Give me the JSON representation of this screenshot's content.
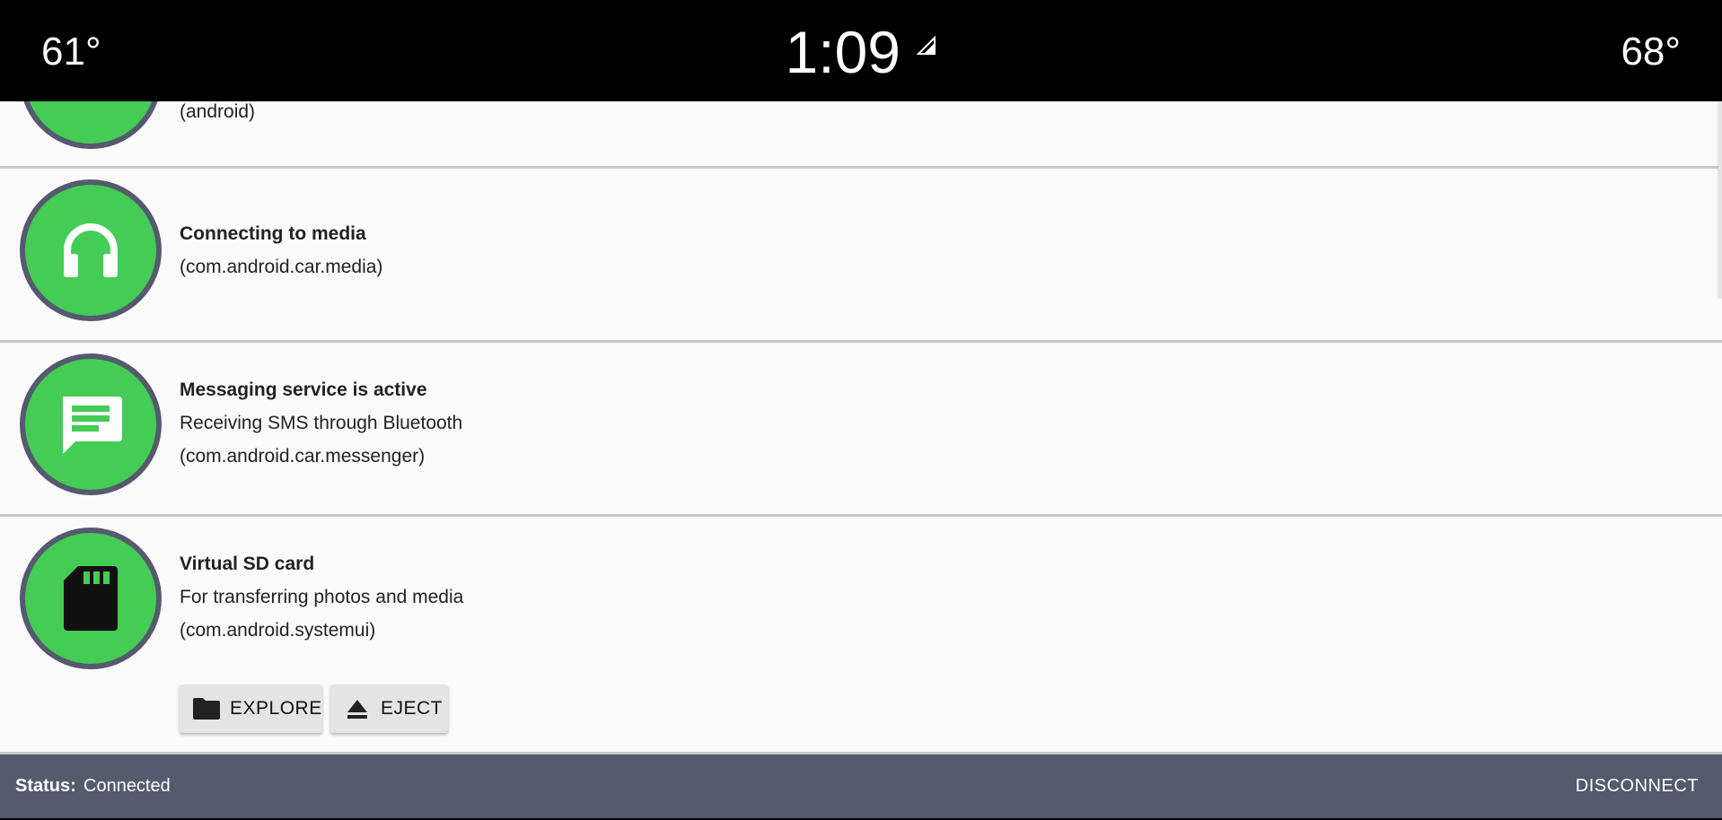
{
  "status_bar": {
    "temp_left": "61°",
    "clock": "1:09",
    "temp_right": "68°"
  },
  "notifications": [
    {
      "icon": "android-icon",
      "title": "",
      "lines": [
        "(android)"
      ]
    },
    {
      "icon": "headphones-icon",
      "title": "Connecting to media",
      "lines": [
        "(com.android.car.media)"
      ]
    },
    {
      "icon": "message-icon",
      "title": "Messaging service is active",
      "lines": [
        "Receiving SMS through Bluetooth",
        "(com.android.car.messenger)"
      ]
    },
    {
      "icon": "sd-card-icon",
      "title": "Virtual SD card",
      "lines": [
        "For transferring photos and media",
        "(com.android.systemui)"
      ]
    }
  ],
  "actions": {
    "explore_label": "EXPLORE",
    "eject_label": "EJECT"
  },
  "footer": {
    "status_label": "Status:",
    "status_value": "Connected",
    "disconnect_label": "DISCONNECT"
  },
  "colors": {
    "icon_green": "#44cc55",
    "icon_ring": "#555a6e",
    "footer_bg": "#555a6e",
    "list_bg": "#fafafa"
  }
}
